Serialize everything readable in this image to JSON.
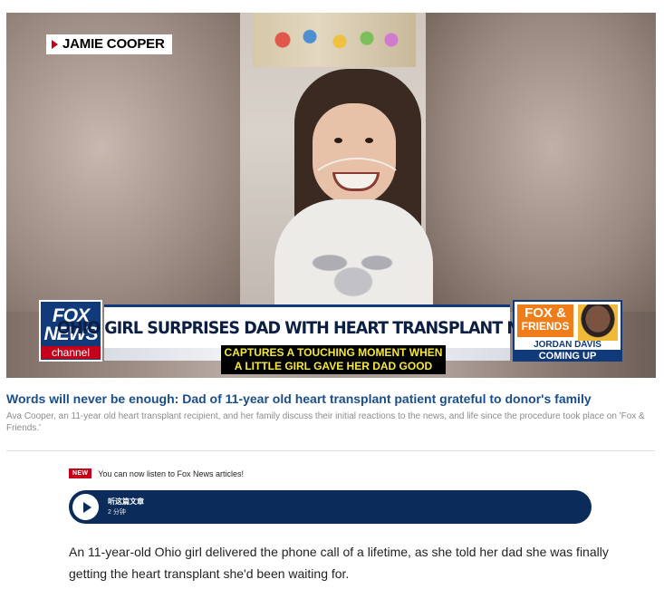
{
  "video": {
    "name_tag": "JAMIE COOPER",
    "network_logo": [
      "FOX",
      "NEWS",
      "channel"
    ],
    "headline": "OHIO GIRL SURPRISES DAD WITH HEART TRANSPLANT NEWS",
    "show_logo": [
      "FOX &",
      "FRIENDS"
    ],
    "show_host": "JORDAN DAVIS",
    "show_status": "COMING UP",
    "caption_line1": "CAPTURES A TOUCHING MOMENT WHEN",
    "caption_line2": "A LITTLE GIRL GAVE HER DAD GOOD"
  },
  "article": {
    "video_title": "Words will never be enough: Dad of 11-year old heart transplant patient grateful to donor's family",
    "video_description": "Ava Cooper, an 11-year old heart transplant recipient, and her family discuss their initial reactions to the news, and life since the procedure took place on 'Fox & Friends.'",
    "listen_badge": "NEW",
    "listen_note": "You can now listen to Fox News articles!",
    "player_title": "听这篇文章",
    "player_duration": "2 分钟",
    "body": "An 11-year-old Ohio girl delivered the phone call of a lifetime, as she told her dad she was finally getting the heart transplant she'd been waiting for."
  },
  "colors": {
    "accent_red": "#c4001a",
    "fox_blue": "#103a7a",
    "title_blue": "#1a4e8a",
    "player_bg": "#0b2c5a",
    "caption_yellow": "#f5e83a"
  }
}
